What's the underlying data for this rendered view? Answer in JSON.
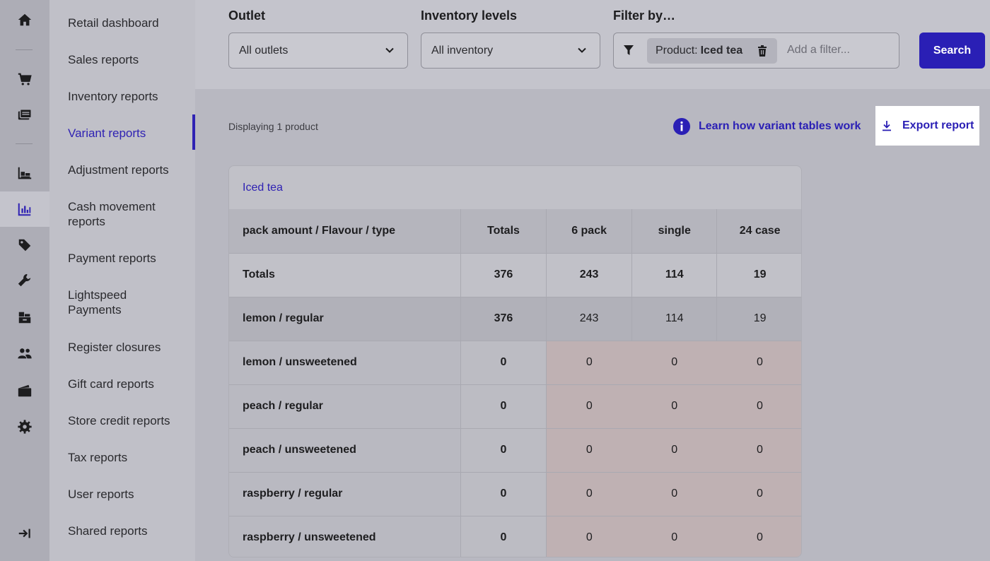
{
  "rail": {
    "icons": [
      "home-icon",
      "cart-icon",
      "register-icon",
      "inventory-icon",
      "reports-icon",
      "tag-icon",
      "wrench-icon",
      "stock-icon",
      "customers-icon",
      "wallet-icon",
      "settings-icon",
      "expand-icon"
    ]
  },
  "menu": {
    "items": [
      {
        "label": "Retail dashboard"
      },
      {
        "label": "Sales reports"
      },
      {
        "label": "Inventory reports"
      },
      {
        "label": "Variant reports"
      },
      {
        "label": "Adjustment reports"
      },
      {
        "label": "Cash movement reports"
      },
      {
        "label": "Payment reports"
      },
      {
        "label": "Lightspeed Payments"
      },
      {
        "label": "Register closures"
      },
      {
        "label": "Gift card reports"
      },
      {
        "label": "Store credit reports"
      },
      {
        "label": "Tax reports"
      },
      {
        "label": "User reports"
      },
      {
        "label": "Shared reports"
      }
    ],
    "active": "Variant reports"
  },
  "filters": {
    "outlet_label": "Outlet",
    "outlet_value": "All outlets",
    "inventory_label": "Inventory levels",
    "inventory_value": "All inventory",
    "filter_label": "Filter by…",
    "chip_prefix": "Product:",
    "chip_value": "Iced tea",
    "add_filter_placeholder": "Add a filter...",
    "search_label": "Search"
  },
  "content": {
    "display_count": "Displaying 1 product",
    "learn_link": "Learn how variant tables work",
    "export_label": "Export report"
  },
  "table": {
    "product": "Iced tea",
    "headers": [
      "pack amount / Flavour / type",
      "Totals",
      "6 pack",
      "single",
      "24 case"
    ],
    "totals_row": [
      "Totals",
      "376",
      "243",
      "114",
      "19"
    ],
    "rows": [
      [
        "lemon / regular",
        "376",
        "243",
        "114",
        "19"
      ],
      [
        "lemon / unsweetened",
        "0",
        "0",
        "0",
        "0"
      ],
      [
        "peach / regular",
        "0",
        "0",
        "0",
        "0"
      ],
      [
        "peach / unsweetened",
        "0",
        "0",
        "0",
        "0"
      ],
      [
        "raspberry / regular",
        "0",
        "0",
        "0",
        "0"
      ],
      [
        "raspberry / unsweetened",
        "0",
        "0",
        "0",
        "0"
      ]
    ]
  },
  "colors": {
    "accent": "#2a1fb5",
    "zero_cell_tint": "#bfb1b3"
  }
}
